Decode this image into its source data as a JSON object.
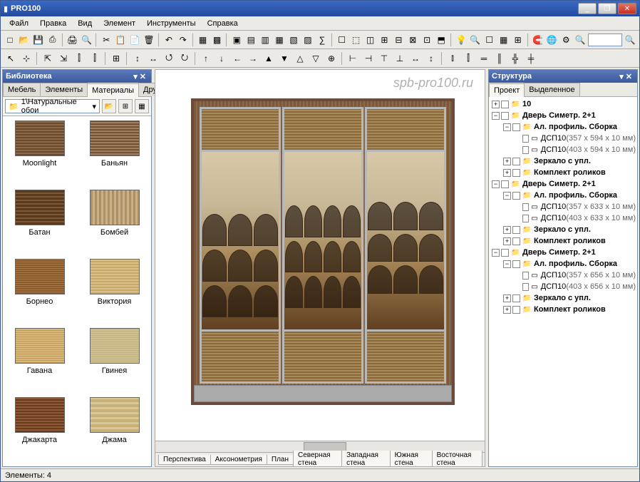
{
  "app": {
    "title": "PRO100"
  },
  "winbtns": {
    "min": "_",
    "max": "❐",
    "close": "✕"
  },
  "menu": [
    "Файл",
    "Правка",
    "Вид",
    "Элемент",
    "Инструменты",
    "Справка"
  ],
  "watermark": "spb-pro100.ru",
  "library": {
    "title": "Библиотека",
    "tabs": {
      "furniture": "Мебель",
      "elements": "Элементы",
      "materials": "Материалы",
      "other": "Другое"
    },
    "path": "1\\Натуральные обои",
    "materials": [
      {
        "name": "Moonlight",
        "cls": "wood1"
      },
      {
        "name": "Баньян",
        "cls": "wood2"
      },
      {
        "name": "Батан",
        "cls": "wood3"
      },
      {
        "name": "Бомбей",
        "cls": "wood4"
      },
      {
        "name": "Борнео",
        "cls": "wood5"
      },
      {
        "name": "Виктория",
        "cls": "wood6"
      },
      {
        "name": "Гавана",
        "cls": "wood7"
      },
      {
        "name": "Гвинея",
        "cls": "wood8"
      },
      {
        "name": "Джакарта",
        "cls": "wood9"
      },
      {
        "name": "Джама",
        "cls": "wood10"
      }
    ]
  },
  "viewtabs": [
    "Перспектива",
    "Аксонометрия",
    "План",
    "Северная стена",
    "Западная стена",
    "Южная стена",
    "Восточная стена"
  ],
  "structure": {
    "title": "Структура",
    "tabs": {
      "project": "Проект",
      "selected": "Выделенное"
    },
    "nodes": [
      {
        "d": 0,
        "exp": "+",
        "bold": true,
        "ico": "📁",
        "label": "10"
      },
      {
        "d": 0,
        "exp": "−",
        "bold": true,
        "ico": "📁",
        "label": "Дверь Симетр. 2+1"
      },
      {
        "d": 1,
        "exp": "−",
        "bold": true,
        "ico": "📁",
        "label": "Ал. профиль. Сборка"
      },
      {
        "d": 2,
        "exp": "",
        "ico": "▭",
        "label": "ДСП10",
        "dim": "(357 x 594 x 10 мм)"
      },
      {
        "d": 2,
        "exp": "",
        "ico": "▭",
        "label": "ДСП10",
        "dim": "(403 x 594 x 10 мм)"
      },
      {
        "d": 1,
        "exp": "+",
        "bold": true,
        "ico": "📁",
        "label": "Зеркало с упл."
      },
      {
        "d": 1,
        "exp": "+",
        "bold": true,
        "ico": "📁",
        "label": "Комплект роликов"
      },
      {
        "d": 0,
        "exp": "−",
        "bold": true,
        "ico": "📁",
        "label": "Дверь Симетр. 2+1"
      },
      {
        "d": 1,
        "exp": "−",
        "bold": true,
        "ico": "📁",
        "label": "Ал. профиль. Сборка"
      },
      {
        "d": 2,
        "exp": "",
        "ico": "▭",
        "label": "ДСП10",
        "dim": "(357 x 633 x 10 мм)"
      },
      {
        "d": 2,
        "exp": "",
        "ico": "▭",
        "label": "ДСП10",
        "dim": "(403 x 633 x 10 мм)"
      },
      {
        "d": 1,
        "exp": "+",
        "bold": true,
        "ico": "📁",
        "label": "Зеркало с упл."
      },
      {
        "d": 1,
        "exp": "+",
        "bold": true,
        "ico": "📁",
        "label": "Комплект роликов"
      },
      {
        "d": 0,
        "exp": "−",
        "bold": true,
        "ico": "📁",
        "label": "Дверь Симетр. 2+1"
      },
      {
        "d": 1,
        "exp": "−",
        "bold": true,
        "ico": "📁",
        "label": "Ал. профиль. Сборка"
      },
      {
        "d": 2,
        "exp": "",
        "ico": "▭",
        "label": "ДСП10",
        "dim": "(357 x 656 x 10 мм)"
      },
      {
        "d": 2,
        "exp": "",
        "ico": "▭",
        "label": "ДСП10",
        "dim": "(403 x 656 x 10 мм)"
      },
      {
        "d": 1,
        "exp": "+",
        "bold": true,
        "ico": "📁",
        "label": "Зеркало с упл."
      },
      {
        "d": 1,
        "exp": "+",
        "bold": true,
        "ico": "📁",
        "label": "Комплект роликов"
      }
    ]
  },
  "status": {
    "elements": "Элементы: 4"
  },
  "toolbar_icons": {
    "r1": [
      "□",
      "📂",
      "💾",
      "⎙",
      "|",
      "🖨",
      "🔍",
      "|",
      "✂",
      "📋",
      "📄",
      "🗑",
      "|",
      "↶",
      "↷",
      "|",
      "▦",
      "▩",
      "|",
      "▣",
      "▤",
      "▥",
      "▦",
      "▧",
      "▨",
      "∑",
      "|",
      "☐",
      "⬚",
      "◫",
      "⊞",
      "⊟",
      "⊠",
      "⊡",
      "⬒",
      "|",
      "💡",
      "🔍",
      "☐",
      "▦",
      "⊞",
      "|",
      "🧲",
      "🌐",
      "⚙",
      "🔍"
    ],
    "r2": [
      "↖",
      "⊹",
      "|",
      "⇱",
      "⇲",
      "⫿",
      "⫿",
      "|",
      "⊞",
      "|",
      "↕",
      "↔",
      "⭯",
      "⭮",
      "|",
      "↑",
      "↓",
      "←",
      "→",
      "▲",
      "▼",
      "△",
      "▽",
      "⊕",
      "|",
      "⊢",
      "⊣",
      "⊤",
      "⊥",
      "↔",
      "↕",
      "|",
      "⫾",
      "⫿",
      "═",
      "║",
      "╬",
      "╪"
    ]
  }
}
